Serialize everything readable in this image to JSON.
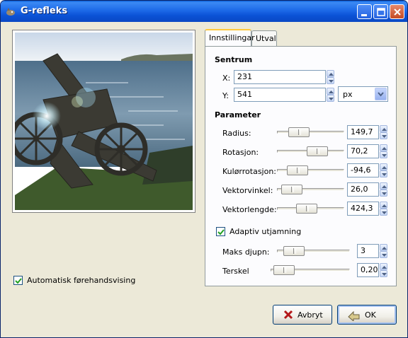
{
  "window": {
    "title": "G-refleks",
    "icon": "gimp-icon",
    "controls": [
      "minimize-icon",
      "maximize-icon",
      "close-icon"
    ]
  },
  "preview": {
    "auto_preview_label": "Automatisk førehandsvising",
    "auto_preview_checked": true
  },
  "tabs": [
    {
      "label": "Innstillingar",
      "active": true
    },
    {
      "label": "Utval",
      "active": false
    }
  ],
  "center": {
    "title": "Sentrum",
    "x_label": "X:",
    "x_value": "231",
    "y_label": "Y:",
    "y_value": "541",
    "unit": "px"
  },
  "parameters": {
    "title": "Parameter",
    "rows": [
      {
        "label": "Radius:",
        "value": "149,7"
      },
      {
        "label": "Rotasjon:",
        "value": "70,2"
      },
      {
        "label": "Kulørrotasjon:",
        "value": "-94,6"
      },
      {
        "label": "Vektorvinkel:",
        "value": "26,0"
      },
      {
        "label": "Vektorlengde:",
        "value": "424,3"
      }
    ]
  },
  "adaptive": {
    "label": "Adaptiv utjamning",
    "checked": true,
    "rows": [
      {
        "label": "Maks djupn:",
        "value": "3"
      },
      {
        "label": "Terskel",
        "value": "0,20"
      }
    ]
  },
  "buttons": {
    "cancel": "Avbryt",
    "ok": "OK"
  },
  "colors": {
    "titlebar": "#0b52d6",
    "face": "#ece9d8",
    "tab_highlight": "#ffc83c",
    "check": "#21a121"
  }
}
